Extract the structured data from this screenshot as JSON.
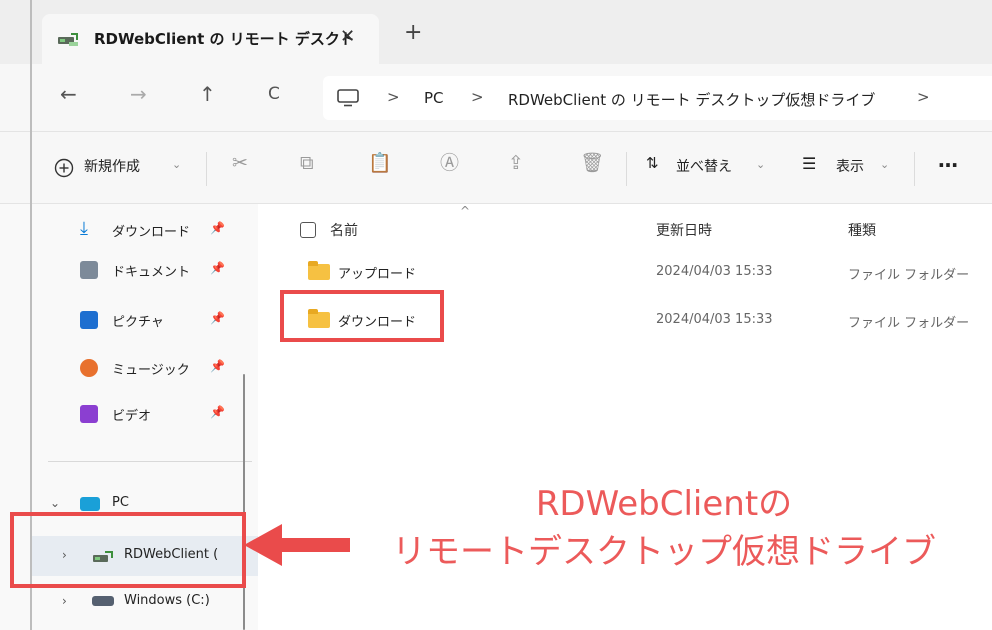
{
  "tab": {
    "title": "RDWebClient の リモート デスクト",
    "close": "✕",
    "new": "+"
  },
  "nav": {
    "back": "←",
    "forward": "→",
    "up": "↑",
    "refresh": "C"
  },
  "address": {
    "segments": [
      "PC",
      "RDWebClient の リモート デスクトップ仮想ドライブ"
    ],
    "separator": ">"
  },
  "commands": {
    "new_label": "新規作成",
    "sort_label": "並べ替え",
    "view_label": "表示",
    "more": "…",
    "caret": "⌄"
  },
  "sidebar": {
    "quick": [
      {
        "label": "ダウンロード",
        "icon": "download-icon"
      },
      {
        "label": "ドキュメント",
        "icon": "documents-icon"
      },
      {
        "label": "ピクチャ",
        "icon": "pictures-icon"
      },
      {
        "label": "ミュージック",
        "icon": "music-icon"
      },
      {
        "label": "ビデオ",
        "icon": "videos-icon"
      }
    ],
    "pin": "📌",
    "pc_label": "PC",
    "drive_label": "RDWebClient (",
    "windows_label": "Windows (C:)"
  },
  "columns": {
    "name": "名前",
    "date": "更新日時",
    "type": "種類"
  },
  "rows": [
    {
      "name": "アップロード",
      "date": "2024/04/03 15:33",
      "type": "ファイル フォルダー"
    },
    {
      "name": "ダウンロード",
      "date": "2024/04/03 15:33",
      "type": "ファイル フォルダー"
    }
  ],
  "callout": {
    "line1": "RDWebClientの",
    "line2": "リモートデスクトップ仮想ドライブ"
  },
  "colors": {
    "accent_red": "#ea4b4b",
    "folder": "#f6c142",
    "download_blue": "#0a7bd6"
  }
}
